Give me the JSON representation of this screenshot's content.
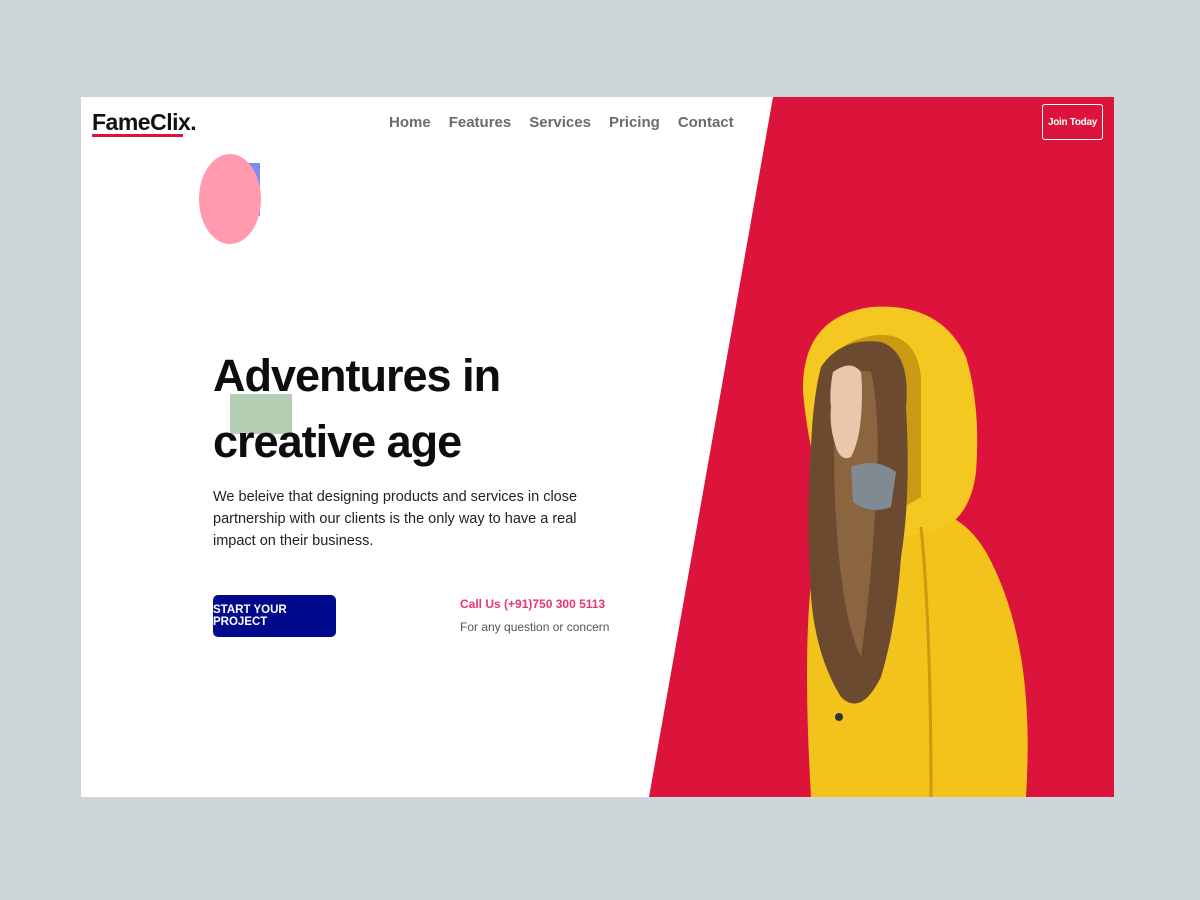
{
  "brand": {
    "logo": "FameClix."
  },
  "nav": {
    "items": [
      "Home",
      "Features",
      "Services",
      "Pricing",
      "Contact"
    ],
    "join_label": "Join Today"
  },
  "hero": {
    "headline_line1": "Adventures in",
    "headline_line2": "creative age",
    "description": "We beleive that designing products and services in close partnership with our clients is the only way to have a real impact on their business.",
    "cta_label": "START YOUR PROJECT",
    "call_us": "Call Us (+91)750 300 5113",
    "call_note": "For any question or concern"
  },
  "colors": {
    "accent_red": "#dc143c",
    "cta_blue": "#010a8c",
    "jacket_yellow": "#f5c518"
  }
}
